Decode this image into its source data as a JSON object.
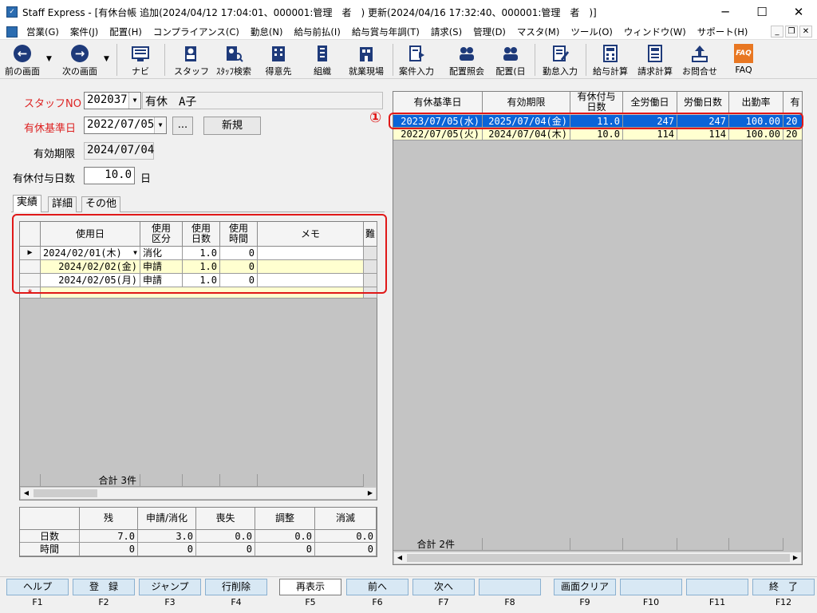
{
  "window": {
    "title": "Staff Express - [有休台帳  追加(2024/04/12 17:04:01、000001:管理　者　)  更新(2024/04/16 17:32:40、000001:管理　者　)]",
    "min": "─",
    "max": "☐",
    "close": "✕"
  },
  "menu": [
    "営業(G)",
    "案件(J)",
    "配置(H)",
    "コンプライアンス(C)",
    "勤怠(N)",
    "給与前払(I)",
    "給与賞与年調(T)",
    "請求(S)",
    "管理(D)",
    "マスタ(M)",
    "ツール(O)",
    "ウィンドウ(W)",
    "サポート(H)"
  ],
  "mdi": {
    "min": "_",
    "restore": "❐",
    "close": "✕"
  },
  "toolbar": {
    "prev": "前の画面",
    "next": "次の画面",
    "navi": "ナビ",
    "staff": "スタッフ",
    "staff_search": "ｽﾀｯﾌ検索",
    "client": "得意先",
    "org": "組織",
    "worksite": "就業現場",
    "case_input": "案件入力",
    "assign_query": "配置照会",
    "assign_day": "配置(日",
    "attendance": "勤怠入力",
    "payroll": "給与計算",
    "billing": "請求計算",
    "inquiry": "お問合せ",
    "faq": "FAQ"
  },
  "form": {
    "staff_label": "スタッフNO",
    "staff_no": "202037",
    "staff_name": "有休　A子",
    "base_label": "有休基準日",
    "base_date": "2022/07/05",
    "ellipsis": "...",
    "new_btn": "新規",
    "valid_label": "有効期限",
    "valid_date": "2024/07/04",
    "grant_label": "有休付与日数",
    "grant_days": "10.0",
    "day_unit": "日"
  },
  "tabs": [
    "実績",
    "詳細",
    "その他"
  ],
  "left_grid": {
    "headers": [
      "使用日",
      "使用\n区分",
      "使用\n日数",
      "使用\n時間",
      "メモ",
      "難"
    ],
    "rows": [
      {
        "date": "2024/02/01(木)",
        "kubun": "消化",
        "days": "1.0",
        "hours": "0",
        "memo": ""
      },
      {
        "date": "2024/02/02(金)",
        "kubun": "申請",
        "days": "1.0",
        "hours": "0",
        "memo": ""
      },
      {
        "date": "2024/02/05(月)",
        "kubun": "申請",
        "days": "1.0",
        "hours": "0",
        "memo": ""
      }
    ],
    "new_marker": "*",
    "row_pointer": "▶",
    "total": "合計  3件"
  },
  "summary": {
    "headers": [
      "残",
      "申請/消化",
      "喪失",
      "調整",
      "消滅"
    ],
    "rows": [
      {
        "label": "日数",
        "vals": [
          "7.0",
          "3.0",
          "0.0",
          "0.0",
          "0.0"
        ]
      },
      {
        "label": "時間",
        "vals": [
          "0",
          "0",
          "0",
          "0",
          "0"
        ]
      }
    ]
  },
  "right_grid": {
    "headers": [
      "有休基準日",
      "有効期限",
      "有休付与\n日数",
      "全労働日",
      "労働日数",
      "出勤率",
      "有"
    ],
    "rows": [
      {
        "base": "2023/07/05(水)",
        "valid": "2025/07/04(金)",
        "grant": "11.0",
        "all": "247",
        "work": "247",
        "rate": "100.00",
        "more": "20"
      },
      {
        "base": "2022/07/05(火)",
        "valid": "2024/07/04(木)",
        "grant": "10.0",
        "all": "114",
        "work": "114",
        "rate": "100.00",
        "more": "20"
      }
    ],
    "total": "合計  2件",
    "marker": "①"
  },
  "fkeys": [
    {
      "label": "ヘルプ",
      "key": "F1"
    },
    {
      "label": "登　録",
      "key": "F2"
    },
    {
      "label": "ジャンプ",
      "key": "F3"
    },
    {
      "label": "行削除",
      "key": "F4"
    },
    {
      "label": "再表示",
      "key": "F5"
    },
    {
      "label": "前へ",
      "key": "F6"
    },
    {
      "label": "次へ",
      "key": "F7"
    },
    {
      "label": "",
      "key": "F8"
    },
    {
      "label": "画面クリア",
      "key": "F9"
    },
    {
      "label": "",
      "key": "F10"
    },
    {
      "label": "",
      "key": "F11"
    },
    {
      "label": "終　了",
      "key": "F12"
    }
  ],
  "colors": {
    "accent": "#0a64d8",
    "highlight_row": "#ffffd0",
    "annotation": "#e01818"
  }
}
